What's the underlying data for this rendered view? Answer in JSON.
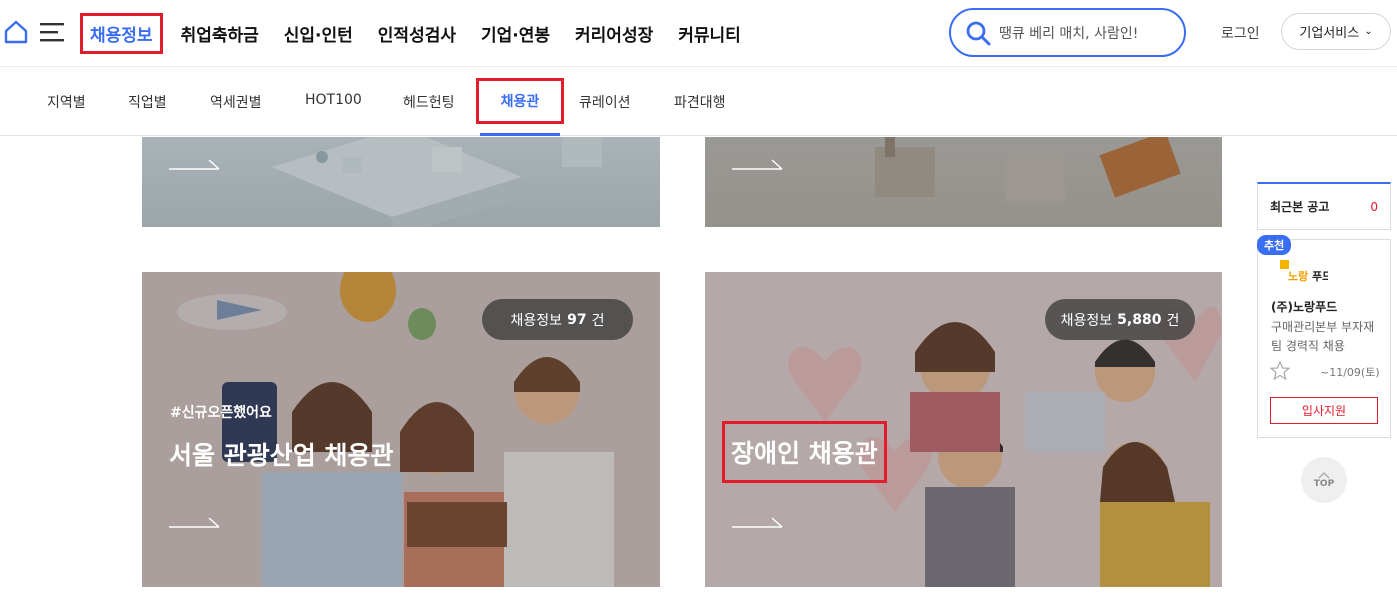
{
  "header": {
    "nav": [
      "채용정보",
      "취업축하금",
      "신입·인턴",
      "인적성검사",
      "기업·연봉",
      "커리어성장",
      "커뮤니티"
    ],
    "search_placeholder": "땡큐 베리 매치, 사람인!",
    "login_label": "로그인",
    "corp_service_label": "기업서비스"
  },
  "subnav": {
    "items": [
      "지역별",
      "직업별",
      "역세권별",
      "HOT100",
      "헤드헌팅",
      "채용관",
      "큐레이션",
      "파견대행"
    ],
    "active_index": 5
  },
  "cards": [
    {
      "count_prefix": "채용정보",
      "count_value": "97",
      "count_suffix": "건",
      "tag": "#신규오픈했어요",
      "title": "서울 관광산업 채용관"
    },
    {
      "count_prefix": "채용정보",
      "count_value": "5,880",
      "count_suffix": "건",
      "title": "장애인 채용관"
    }
  ],
  "sidebar": {
    "recent_label": "최근본 공고",
    "recent_count": "0",
    "recommend_badge": "추천",
    "company": "(주)노랑푸드",
    "description": "구매관리본부 부자재팀 경력직 채용",
    "deadline": "~11/09(토)",
    "apply_label": "입사지원",
    "top_label": "TOP"
  },
  "colors": {
    "accent": "#3a6ef2",
    "highlight": "#e21c2a"
  }
}
